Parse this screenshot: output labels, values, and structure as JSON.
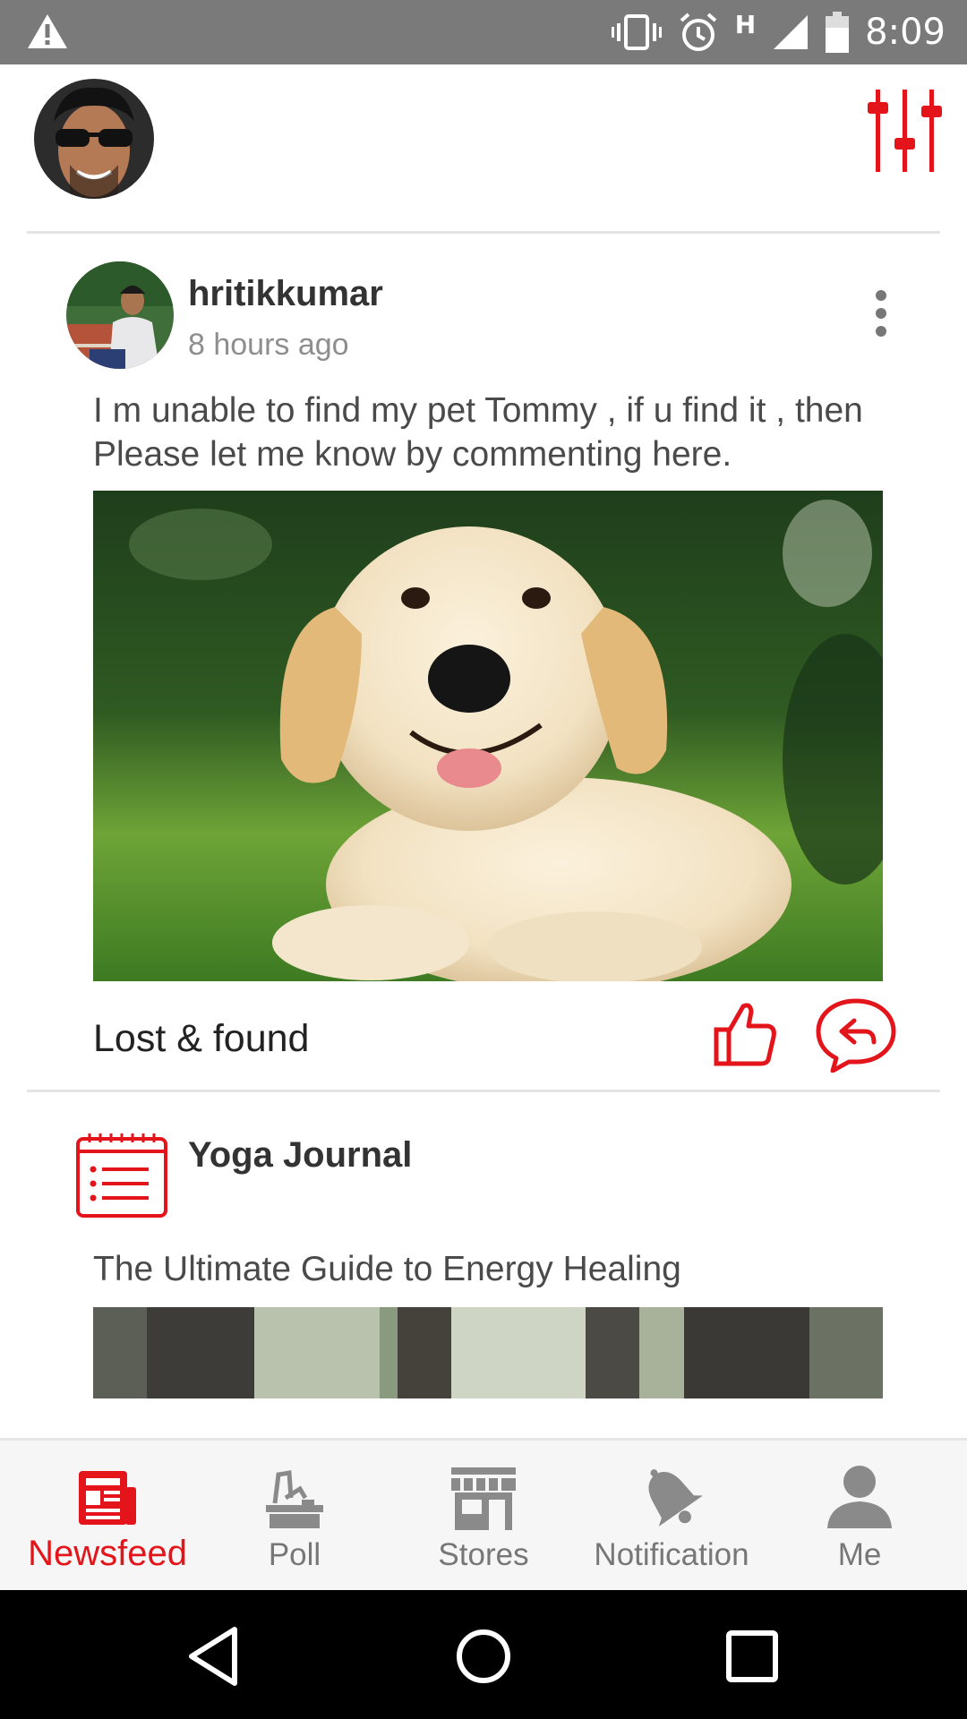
{
  "status_bar": {
    "time": "8:09",
    "network": "H"
  },
  "post": {
    "username": "hritikkumar",
    "time_ago": "8 hours ago",
    "text": "I m unable to find my pet Tommy , if u find it , then Please let me know by commenting here.",
    "category": "Lost & found"
  },
  "article": {
    "source": "Yoga Journal",
    "headline": "The Ultimate Guide to Energy Healing"
  },
  "tabs": [
    {
      "label": "Newsfeed",
      "icon": "newspaper-icon",
      "active": true
    },
    {
      "label": "Poll",
      "icon": "ballot-box-icon",
      "active": false
    },
    {
      "label": "Stores",
      "icon": "store-icon",
      "active": false
    },
    {
      "label": "Notification",
      "icon": "bell-icon",
      "active": false
    },
    {
      "label": "Me",
      "icon": "person-icon",
      "active": false
    }
  ],
  "colors": {
    "accent": "#e4141b",
    "status_bar": "#7a7a7a",
    "tab_inactive": "#777777"
  }
}
